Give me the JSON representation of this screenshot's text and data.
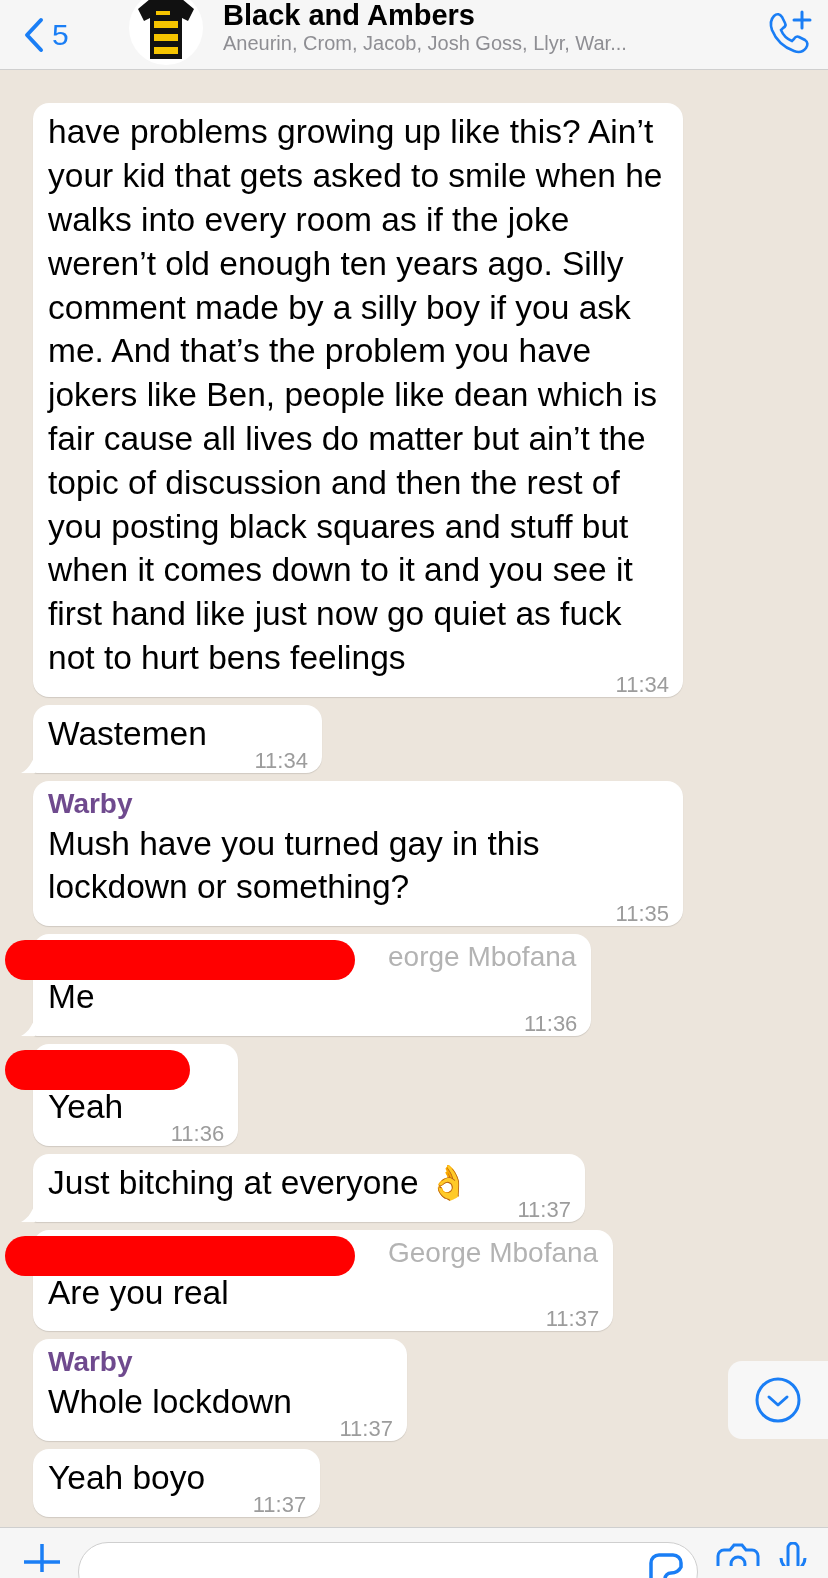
{
  "header": {
    "back_count": "5",
    "title": "Black and Ambers",
    "subtitle": "Aneurin, Crom, Jacob, Josh Goss, Llyr, War..."
  },
  "messages": [
    {
      "text": "have problems growing up like this? Ain’t your kid that gets asked to smile when he walks into every room as if the joke weren’t old enough ten years ago. Silly comment made by a silly boy if you ask me. And that’s the problem you have jokers like Ben, people like dean which is fair cause all lives do matter but ain’t the topic of discussion and then the rest of you posting black squares and stuff but when it comes down to it and you see it first hand like just now go quiet as fuck not to hurt bens feelings",
      "time": "11:34",
      "redacted": false,
      "tail": false
    },
    {
      "text": "Wastemen",
      "time": "11:34",
      "redacted": false,
      "tail": true
    },
    {
      "sender": "Warby",
      "color": "#6f4a8e",
      "text": "Mush have you turned gay in this lockdown or something?",
      "time": "11:35",
      "redacted": false,
      "tail": false
    },
    {
      "sender": "eorge Mbofana",
      "color": "#b3b3b3",
      "text": "Me",
      "time": "11:36",
      "redacted": true,
      "tail": true
    },
    {
      "text": "Yeah",
      "time": "11:36",
      "redacted": true,
      "tail": false
    },
    {
      "text": "Just bitching at everyone 👌",
      "time": "11:37",
      "redacted": false,
      "tail": true
    },
    {
      "sender": "George Mbofana",
      "color": "#b3b3b3",
      "text": "Are you real",
      "time": "11:37",
      "redacted": true,
      "tail": false
    },
    {
      "sender": "Warby",
      "color": "#6f4a8e",
      "text": "Whole lockdown",
      "time": "11:37",
      "redacted": false,
      "tail": false
    },
    {
      "text": "Yeah boyo",
      "time": "11:37",
      "redacted": false,
      "tail": false
    }
  ]
}
